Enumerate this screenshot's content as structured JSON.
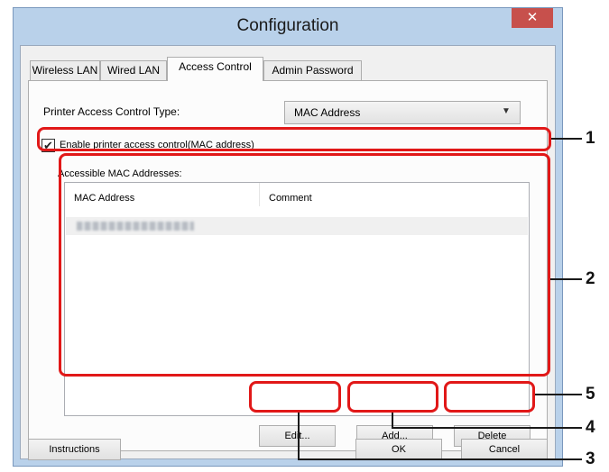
{
  "window": {
    "title": "Configuration",
    "close_glyph": "✕"
  },
  "tabs": [
    {
      "label": "Wireless LAN"
    },
    {
      "label": "Wired LAN"
    },
    {
      "label": "Access Control"
    },
    {
      "label": "Admin Password"
    }
  ],
  "access_control": {
    "type_label": "Printer Access Control Type:",
    "type_value": "MAC Address",
    "enable_checked": true,
    "enable_label": "Enable printer access control(MAC address)",
    "list_label": "Accessible MAC Addresses:",
    "columns": [
      "MAC Address",
      "Comment"
    ],
    "rows": [
      {
        "mac_address": "",
        "comment": ""
      }
    ]
  },
  "buttons": {
    "edit": "Edit...",
    "add": "Add...",
    "delete": "Delete",
    "instructions": "Instructions",
    "ok": "OK",
    "cancel": "Cancel"
  },
  "callouts": [
    "1",
    "2",
    "3",
    "4",
    "5"
  ],
  "colors": {
    "highlight": "#e11818",
    "close_button": "#c7504c",
    "title_bar": "#b9d1ea"
  }
}
